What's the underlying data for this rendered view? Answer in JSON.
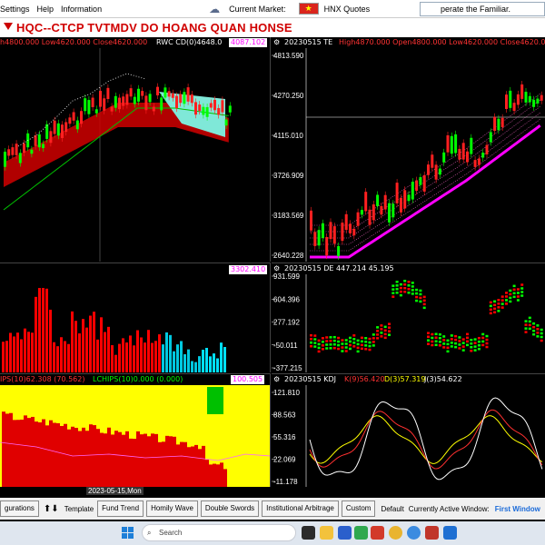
{
  "menu": {
    "settings": "Settings",
    "help": "Help",
    "information": "Information",
    "current_market": "Current Market:",
    "hnx_quotes": "HNX Quotes",
    "ticker": "perate the Familiar."
  },
  "title": "HQC--CTCP TVTMDV DO HOANG QUAN  HONSE",
  "panels": {
    "p1_header": "h4800.000 Low4620.000 Close4620.000",
    "p1_header2": "RWC CD(0)4648.0",
    "p1_value": "4087.102",
    "p2_header": "20230515 TE",
    "p2_header2": "High4870.000 Open4800.000 Low4620.000 Close4620.000",
    "p3_value": "3302.410",
    "p4_header": "20230515 DE 447.214 45.195",
    "p5_header": "IPS(10)62.308 (70.562)",
    "p5_header2": "LCHIPS(10)0.000 (0.000)",
    "p5_value": "100.505",
    "p6_header": "20230515 KDJ",
    "p6_k": "K(9)56.420",
    "p6_d": "D(3)57.319",
    "p6_j": "J(3)54.622"
  },
  "axes": {
    "p2": [
      "4813.590",
      "4270.250",
      "4115.010",
      "3726.909",
      "3183.569",
      "2640.228"
    ],
    "p4": [
      "931.599",
      "604.396",
      "277.192",
      "-50.011",
      "-377.215"
    ],
    "p6": [
      "121.810",
      "88.563",
      "55.316",
      "22.069",
      "-11.178"
    ]
  },
  "date_label": "2023-05-15,Mon",
  "toolbar": {
    "configurations": "gurations",
    "template": "Template",
    "buttons": [
      "Fund Trend",
      "Homily Wave",
      "Double Swords",
      "Institutional Arbitrage",
      "Custom"
    ],
    "default": "Default",
    "active_window_label": "Currently Active Window:",
    "active_window_value": "First Window"
  },
  "taskbar": {
    "search_placeholder": "Search"
  },
  "colors": {
    "up": "#ff0000",
    "down": "#00ff00",
    "magenta": "#ff00ff",
    "yellow": "#ffff00",
    "cyan": "#00ffff",
    "title_red": "#d00000"
  }
}
